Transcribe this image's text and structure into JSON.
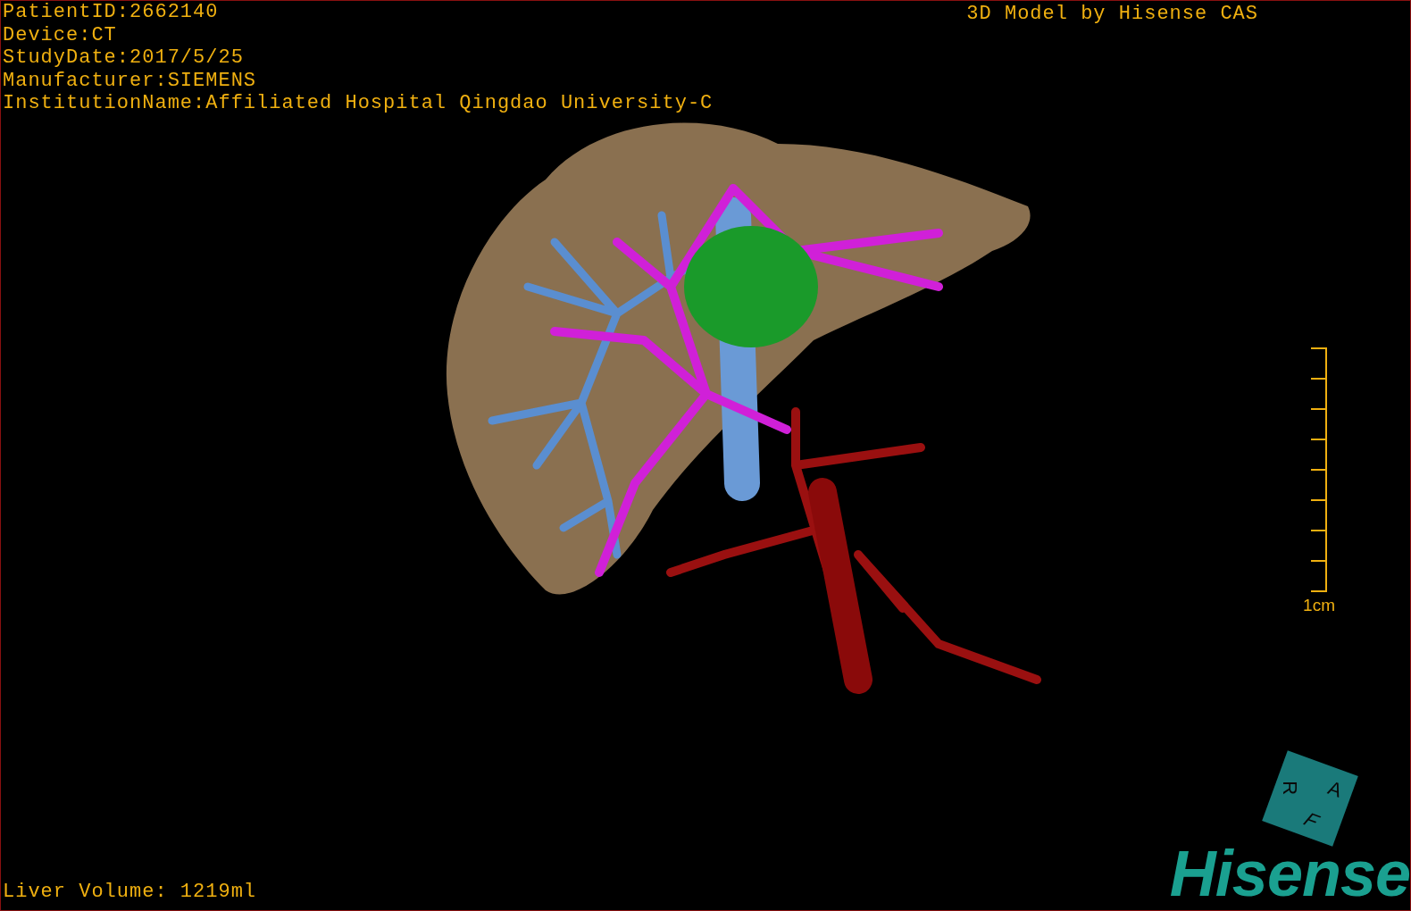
{
  "info_lines": [
    "PatientID:2662140",
    "Device:CT",
    "StudyDate:2017/5/25",
    "Manufacturer:SIEMENS",
    "InstitutionName:Affiliated Hospital Qingdao University-C"
  ],
  "title": "3D Model by Hisense CAS",
  "scale_bar": {
    "label": "1cm"
  },
  "orientation_cube": {
    "faces": [
      "A",
      "R",
      "F"
    ]
  },
  "logo": "Hisense",
  "footer": "Liver Volume: 1219ml"
}
